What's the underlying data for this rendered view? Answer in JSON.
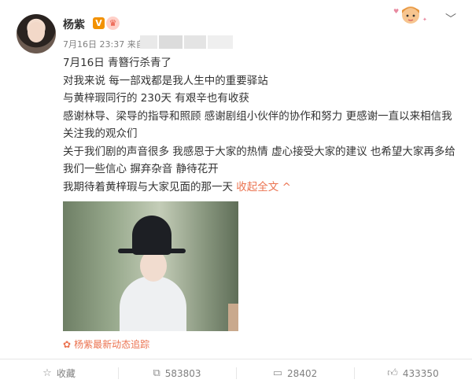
{
  "user": {
    "name": "杨紫",
    "verified_badge": "V",
    "vip_badge": "♛"
  },
  "meta": {
    "time": "7月16日 23:37",
    "source_prefix": "来自"
  },
  "content": {
    "lines": [
      "7月16日  青簪行杀青了",
      "对我来说 每一部戏都是我人生中的重要驿站",
      "与黄梓瑕同行的 230天 有艰辛也有收获",
      "感谢林导、梁导的指导和照顾  感谢剧组小伙伴的协作和努力 更感谢一直以来相信我关注我的观众们",
      "关于我们剧的声音很多  我感恩于大家的热情 虚心接受大家的建议 也希望大家再多给我们一些信心 摒弃杂音 静待花开",
      "我期待着黄梓瑕与大家见面的那一天"
    ],
    "collapse_label": "收起全文 ^"
  },
  "topic": {
    "icon": "flame-icon",
    "label": "杨紫最新动态追踪"
  },
  "actions": {
    "favorite_label": "收藏",
    "repost_count": "583803",
    "comment_count": "28402",
    "like_count": "433350"
  },
  "colors": {
    "accent": "#eb7350",
    "vip_badge_bg": "#f29100",
    "text": "#333333",
    "muted": "#808080"
  }
}
